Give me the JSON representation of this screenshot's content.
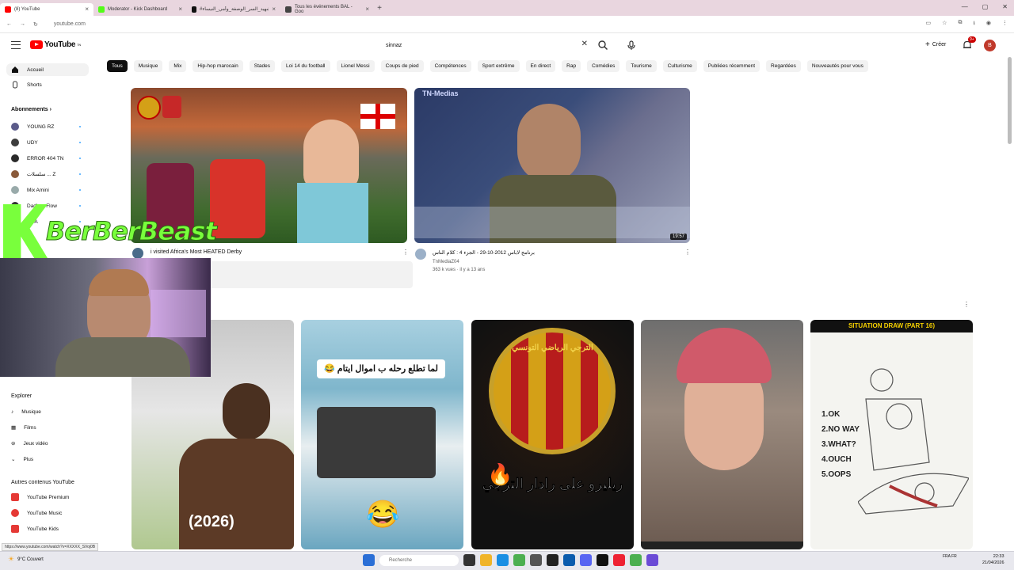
{
  "browser": {
    "tabs": [
      {
        "label": "(8) YouTube",
        "color": "#ff0000"
      },
      {
        "label": "Moderator - Kick Dashboard",
        "color": "#53fc18"
      },
      {
        "label": "#الشهيد_السر_الوصفة_وأمي_النيساء - TikTok",
        "color": "#111111"
      },
      {
        "label": "Tous les événements BAL - Goo",
        "color": "#444444"
      }
    ],
    "url": "youtube.com"
  },
  "header": {
    "logo": "YouTube",
    "logo_sup": "TN",
    "search_value": "sinnaz",
    "create_label": "Créer",
    "notif_count": "9+",
    "avatar_letter": "B"
  },
  "chips": [
    "Tous",
    "Musique",
    "Mix",
    "Hip-hop marocain",
    "Stades",
    "Loi 14 du football",
    "Lionel Messi",
    "Coups de pied",
    "Compétences",
    "Sport extrême",
    "En direct",
    "Rap",
    "Comédies",
    "Tourisme",
    "Culturisme",
    "Publiées récemment",
    "Regardées",
    "Nouveautés pour vous"
  ],
  "sidebar": {
    "home": "Accueil",
    "shorts": "Shorts",
    "subscriptions_head": "Abonnements",
    "subs": [
      {
        "name": "YOUNG RZ",
        "color": "#5b5b8a"
      },
      {
        "name": "UDY",
        "color": "#3d3d3d"
      },
      {
        "name": "ERROR 404 TN",
        "color": "#2a2a2a"
      },
      {
        "name": "سلسلات ... Z",
        "color": "#8a5a3a"
      },
      {
        "name": "Mix Amini",
        "color": "#9aa"
      },
      {
        "name": "Dadboy Flow",
        "color": "#333"
      },
      {
        "name": "FIFA",
        "color": "#1e4d8a"
      }
    ],
    "explore_head": "Explorer",
    "explore": [
      "Musique",
      "Films",
      "Jeux vidéo",
      "Plus"
    ],
    "more_head": "Autres contenus YouTube",
    "more": [
      "YouTube Premium",
      "YouTube Music",
      "YouTube Kids"
    ]
  },
  "videos": [
    {
      "title": "i visited Africa's Most HEATED Derby",
      "channel": "",
      "meta": ""
    },
    {
      "title": "برنامج لاباس 2012-10-29 - الجزء 4 : كلام الناس",
      "channel": "TnMediaZ04",
      "meta": "363 k vues · il y a 13 ans",
      "duration": "19:57",
      "banner": "TN-Medias"
    }
  ],
  "shorts": [
    {
      "caption": "(2026)"
    },
    {
      "caption": "لما تطلع رحله ب اموال ايتام 😂"
    },
    {
      "caption": "ريليرو على رادار الترجي",
      "title": "الترجي الرياضي التونسي"
    },
    {
      "caption": ""
    },
    {
      "caption": "SITUATION DRAW (PART 16)",
      "list": [
        "1.OK",
        "2.NO WAY",
        "3.WHAT?",
        "4.OUCH",
        "5.OOPS"
      ]
    }
  ],
  "overlay": {
    "brand": "BerBerBeast"
  },
  "status_url": "https://www.youtube.com/watch?v=XXXXX_SVoj0B",
  "taskbar": {
    "weather": "9°C Couvert",
    "search": "Recherche",
    "lang": "FRA FR",
    "time": "22:33",
    "date": "21/04/2026"
  }
}
